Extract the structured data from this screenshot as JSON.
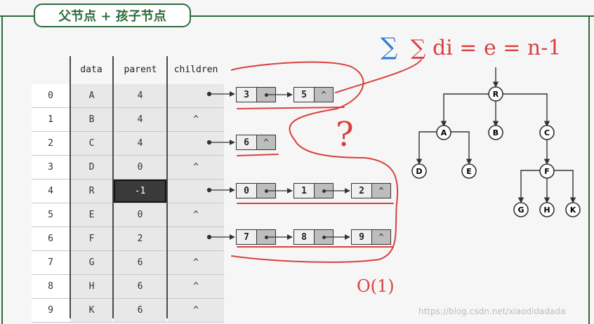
{
  "title": "父节点 + 孩子节点",
  "table": {
    "headers": [
      "data",
      "parent",
      "children"
    ],
    "rows": [
      {
        "index": "0",
        "data": "A",
        "parent": "4",
        "children": ""
      },
      {
        "index": "1",
        "data": "B",
        "parent": "4",
        "children": "^"
      },
      {
        "index": "2",
        "data": "C",
        "parent": "4",
        "children": ""
      },
      {
        "index": "3",
        "data": "D",
        "parent": "0",
        "children": "^"
      },
      {
        "index": "4",
        "data": "R",
        "parent": "-1",
        "children": ""
      },
      {
        "index": "5",
        "data": "E",
        "parent": "0",
        "children": "^"
      },
      {
        "index": "6",
        "data": "F",
        "parent": "2",
        "children": ""
      },
      {
        "index": "7",
        "data": "G",
        "parent": "6",
        "children": "^"
      },
      {
        "index": "8",
        "data": "H",
        "parent": "6",
        "children": "^"
      },
      {
        "index": "9",
        "data": "K",
        "parent": "6",
        "children": "^"
      }
    ]
  },
  "child_lists": {
    "row0": [
      "3",
      "5"
    ],
    "row2": [
      "6"
    ],
    "row4": [
      "0",
      "1",
      "2"
    ],
    "row6": [
      "7",
      "8",
      "9"
    ]
  },
  "null_pointer": "^",
  "tree": {
    "nodes": [
      "R",
      "A",
      "B",
      "C",
      "D",
      "E",
      "F",
      "G",
      "H",
      "K"
    ],
    "edges": [
      [
        "R",
        "A"
      ],
      [
        "R",
        "B"
      ],
      [
        "R",
        "C"
      ],
      [
        "A",
        "D"
      ],
      [
        "A",
        "E"
      ],
      [
        "C",
        "F"
      ],
      [
        "F",
        "G"
      ],
      [
        "F",
        "H"
      ],
      [
        "F",
        "K"
      ]
    ]
  },
  "annotations": {
    "formula": "∑ di = e = n-1",
    "question": "?",
    "complexity": "O(1)"
  },
  "colors": {
    "frame": "#2e6b3c",
    "highlight": "#3a3a3a",
    "pen_red": "#d94040",
    "pen_blue": "#2f7dc8"
  },
  "watermark": "https://blog.csdn.net/xiaodidadada"
}
